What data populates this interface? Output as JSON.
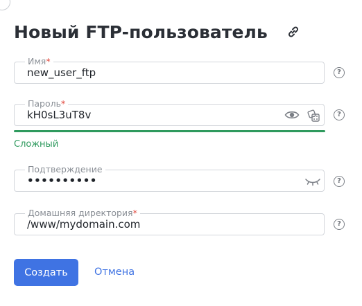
{
  "header": {
    "title": "Новый FTP-пользователь",
    "link_icon": "link-icon"
  },
  "form": {
    "username": {
      "label": "Имя",
      "required_mark": "*",
      "value": "new_user_ftp",
      "help": "?"
    },
    "password": {
      "label": "Пароль",
      "required_mark": "*",
      "value": "kH0sL3uT8v",
      "show_icon": "eye-icon",
      "generate_icon": "dice-icon",
      "help": "?"
    },
    "strength": {
      "text": "Сложный",
      "level": 1.0,
      "color": "#2f9a5e"
    },
    "confirm": {
      "label": "Подтверждение",
      "value": "••••••••••",
      "toggle_icon": "eye-closed-icon",
      "help": "?"
    },
    "home_dir": {
      "label": "Домашняя директория",
      "required_mark": "*",
      "value": "/www/mydomain.com",
      "help": "?"
    }
  },
  "actions": {
    "create_label": "Создать",
    "cancel_label": "Отмена"
  },
  "colors": {
    "primary": "#3f73e3",
    "success": "#2f9a5e",
    "required": "#e0453a"
  }
}
